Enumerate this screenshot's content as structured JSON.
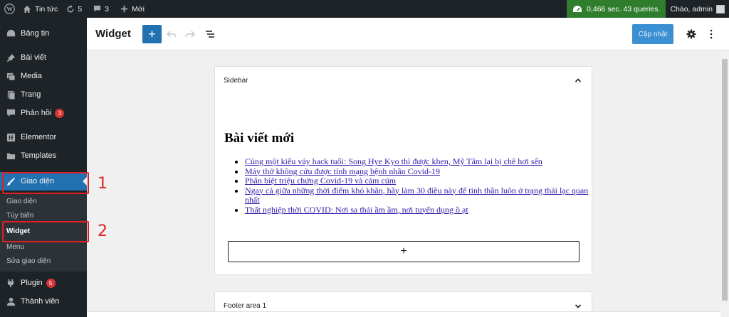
{
  "adminbar": {
    "site_name": "Tin tức",
    "updates_count": "5",
    "comments_count": "3",
    "new_label": "Mới",
    "perf": "0,466 sec. 43 queries.",
    "greeting": "Chào, admin"
  },
  "sidebar": {
    "items": [
      {
        "label": "Bảng tin",
        "icon": "dashboard-icon"
      },
      {
        "label": "Bài viết",
        "icon": "pin-icon"
      },
      {
        "label": "Media",
        "icon": "media-icon"
      },
      {
        "label": "Trang",
        "icon": "page-icon"
      },
      {
        "label": "Phản hồi",
        "icon": "comment-icon",
        "badge": "3"
      },
      {
        "label": "Elementor",
        "icon": "elementor-icon"
      },
      {
        "label": "Templates",
        "icon": "folder-icon"
      },
      {
        "label": "Giao diện",
        "icon": "brush-icon",
        "active": true
      },
      {
        "label": "Plugin",
        "icon": "plugin-icon",
        "badge": "5"
      },
      {
        "label": "Thành viên",
        "icon": "user-icon"
      }
    ],
    "submenu": [
      "Giao diện",
      "Tùy biến",
      "Widget",
      "Menu",
      "Sửa giao diện"
    ],
    "annotations": [
      "1",
      "2"
    ]
  },
  "editor": {
    "title": "Widget",
    "add_label": "+",
    "update_label": "Cập nhật"
  },
  "sidebar_area": {
    "title": "Sidebar",
    "widget_heading": "Bài viết mới",
    "posts": [
      "Cùng một kiểu váy hack tuổi: Song Hye Kyo thì được khen, Mỹ Tâm lại bị chê hơi sến",
      "Máy thở không cứu được tính mạng bệnh nhân Covid-19",
      "Phân biệt triệu chứng Covid-19 và cảm cúm",
      "Ngay cả giữa những thời điểm khó khăn, hãy làm 30 điều này để tinh thần luôn ở trạng thái lạc quan nhất",
      "Thất nghiệp thời COVID: Nơi sa thải ầm ầm, nơi tuyển dụng ồ ạt"
    ],
    "appender_label": "+"
  },
  "footer_area": {
    "title": "Footer area 1"
  },
  "colors": {
    "accent": "#2271b1",
    "admin_bg": "#1d2327",
    "highlight": "#e02020",
    "perf_bg": "#2f7d2d"
  }
}
